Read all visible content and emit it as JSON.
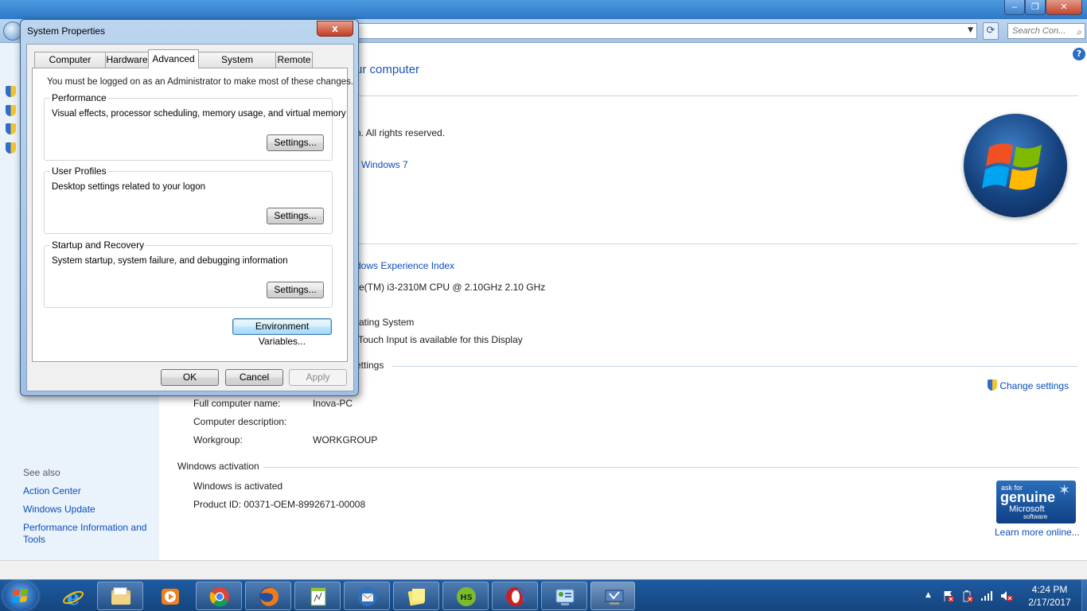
{
  "control_panel": {
    "search_placeholder": "Search Con...",
    "page_heading": "ur computer",
    "copyright": "n.  All rights reserved.",
    "windows_link": "Windows 7",
    "wei_link": "dows Experience Index",
    "processor": "re(TM) i3-2310M CPU @ 2.10GHz   2.10 GHz",
    "system_type": "rating System",
    "pen_touch": "Touch Input is available for this Display",
    "computer_section": "ettings",
    "change_settings": "Change settings",
    "full_name_label": "Full computer name:",
    "full_name_value": "Inova-PC",
    "description_label": "Computer description:",
    "workgroup_label": "Workgroup:",
    "workgroup_value": "WORKGROUP",
    "activation_heading": "Windows activation",
    "activation_status": "Windows is activated",
    "product_id": "Product ID:  00371-OEM-8992671-00008",
    "learn_more": "Learn more online...",
    "genuine": {
      "line1": "ask for",
      "line2": "genuine",
      "line3": "Microsoft",
      "line4": "software"
    },
    "see_also": "See also",
    "see_also_links": [
      "Action Center",
      "Windows Update",
      "Performance Information and",
      "Tools"
    ]
  },
  "dialog": {
    "title": "System Properties",
    "close_label": "x",
    "tabs": [
      "Computer Name",
      "Hardware",
      "Advanced",
      "System Protection",
      "Remote"
    ],
    "active_tab": "Advanced",
    "admin_note": "You must be logged on as an Administrator to make most of these changes.",
    "performance": {
      "label": "Performance",
      "text": "Visual effects, processor scheduling, memory usage, and virtual memory",
      "button": "Settings..."
    },
    "user_profiles": {
      "label": "User Profiles",
      "text": "Desktop settings related to your logon",
      "button": "Settings..."
    },
    "startup": {
      "label": "Startup and Recovery",
      "text": "System startup, system failure, and debugging information",
      "button": "Settings..."
    },
    "env_button": "Environment Variables...",
    "ok": "OK",
    "cancel": "Cancel",
    "apply": "Apply"
  },
  "taskbar": {
    "time": "4:24 PM",
    "date": "2/17/2017",
    "pinned": [
      "explorer-icon",
      "media-player-icon",
      "chrome-icon",
      "firefox-icon",
      "editor-icon",
      "thunderbird-icon",
      "sticky-notes-icon",
      "hotspot-shield-icon",
      "opera-icon",
      "control-panel-icon",
      "remote-desktop-icon"
    ]
  },
  "colors": {
    "link": "#0b4fb8",
    "heading": "#1a56b4",
    "taskbar": "#15457e"
  }
}
